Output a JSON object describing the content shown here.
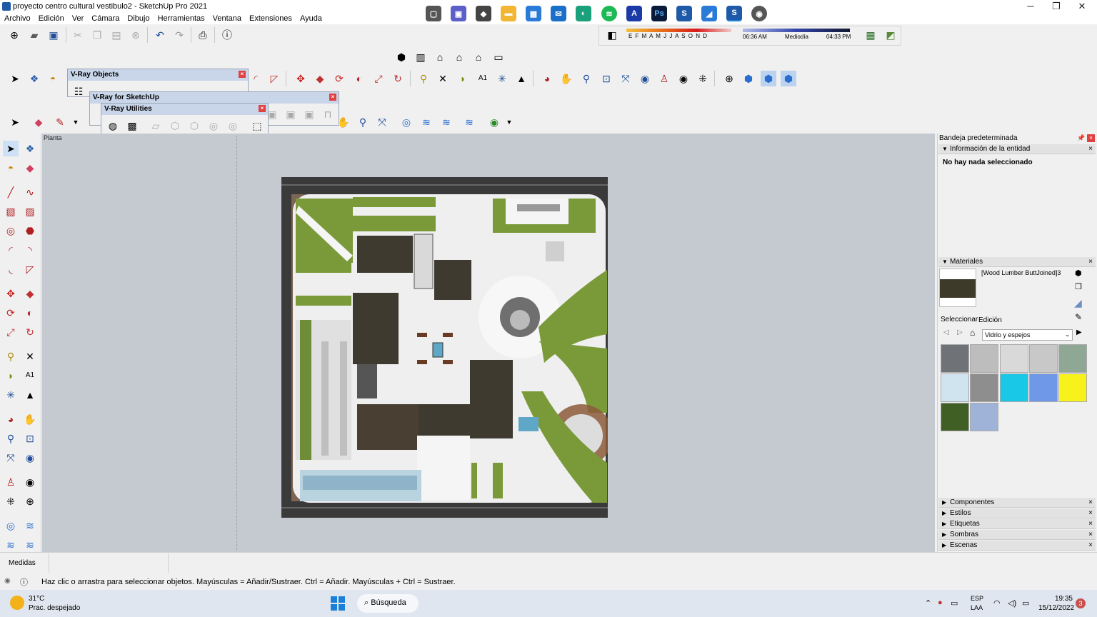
{
  "window": {
    "title": "proyecto centro cultural vestibulo2 - SketchUp Pro 2021",
    "minimize": "─",
    "maximize": "❐",
    "close": "✕"
  },
  "menu": [
    "Archivo",
    "Edición",
    "Ver",
    "Cámara",
    "Dibujo",
    "Herramientas",
    "Ventana",
    "Extensiones",
    "Ayuda"
  ],
  "shadow_bar": {
    "months": "E F M A M J J A S O N D",
    "time_start": "06:36 AM",
    "time_mid": "Mediodía",
    "time_end": "04:33 PM"
  },
  "vray_windows": {
    "objects": "V-Ray Objects",
    "sketchup": "V-Ray for SketchUp",
    "utilities": "V-Ray Utilities"
  },
  "viewport": {
    "scene_label": "Planta"
  },
  "tray": {
    "title": "Bandeja predeterminada",
    "entity_info": {
      "header": "Información de la entidad",
      "message": "No hay nada seleccionado"
    },
    "materials": {
      "header": "Materiales",
      "current_material": "[Wood Lumber ButtJoined]3",
      "tab_select": "Seleccionar",
      "tab_edit": "Edición",
      "library": "Vidrio y espejos",
      "swatch_colors": [
        "#6f7377",
        "#bdbdbd",
        "#d9d9d9",
        "#c8c8c8",
        "#8fa895",
        "#cfe4ef",
        "#8e8e8e",
        "#19c7e6",
        "#6f98e8",
        "#f7f21c",
        "#3f5f24",
        "#9fb2d8"
      ]
    },
    "collapsed_sections": [
      "Componentes",
      "Estilos",
      "Etiquetas",
      "Sombras",
      "Escenas"
    ]
  },
  "measures": {
    "label": "Medidas"
  },
  "status": {
    "message": "Haz clic o arrastra para seleccionar objetos. Mayúsculas = Añadir/Sustraer. Ctrl = Añadir. Mayúsculas + Ctrl = Sustraer."
  },
  "taskbar": {
    "weather_temp": "31°C",
    "weather_desc": "Prac. despejado",
    "search": "Búsqueda",
    "lang_top": "ESP",
    "lang_bottom": "LAA",
    "time": "19:35",
    "date": "15/12/2022",
    "notifications": "3"
  }
}
